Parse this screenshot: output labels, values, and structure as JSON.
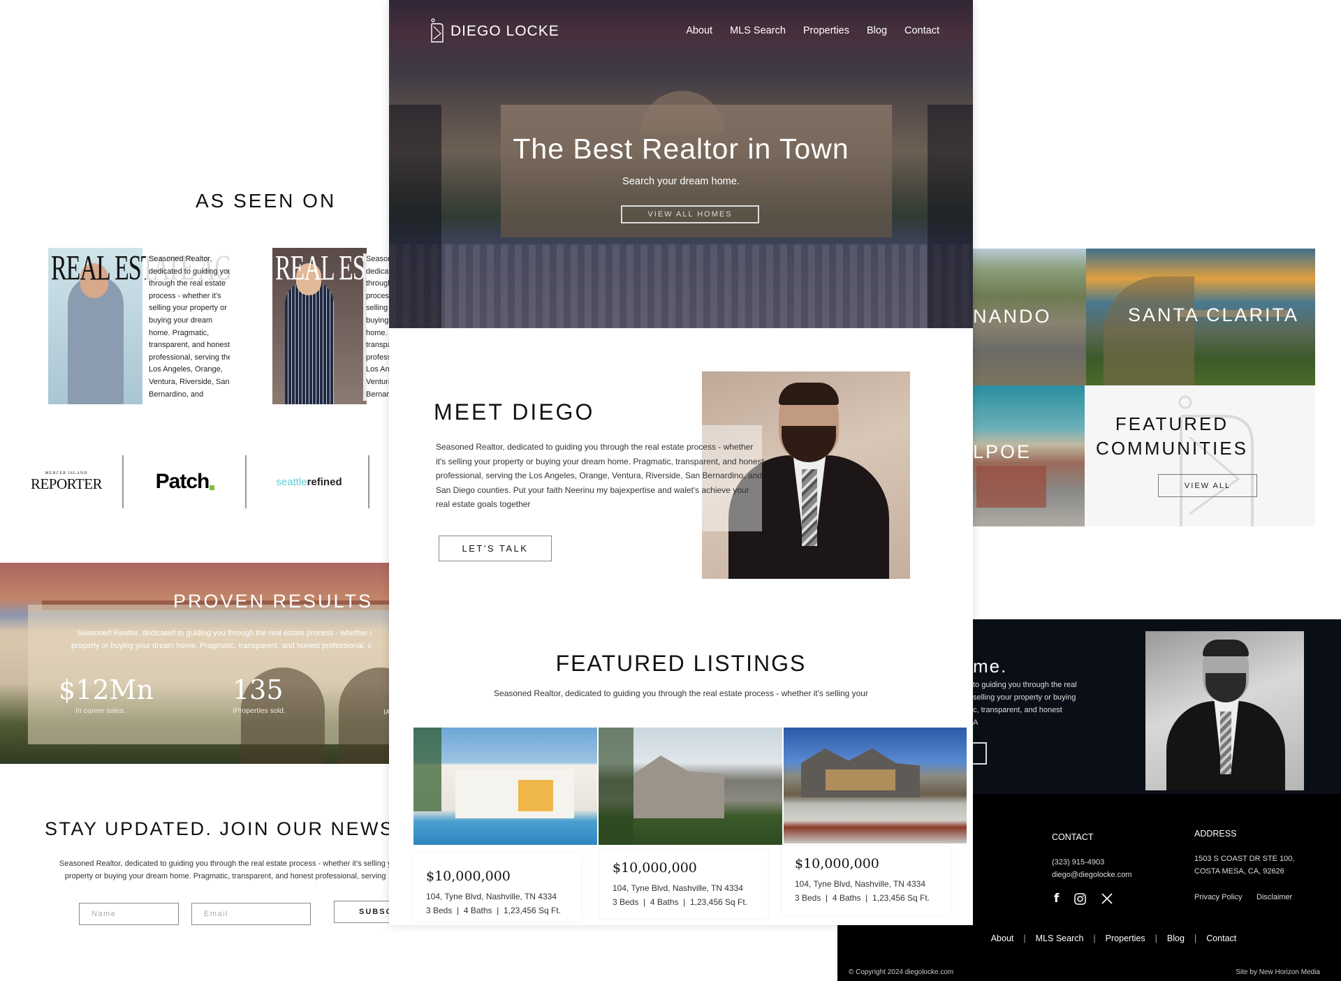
{
  "brand": {
    "name": "DIEGO LOCKE"
  },
  "nav": {
    "items": [
      "About",
      "MLS Search",
      "Properties",
      "Blog",
      "Contact"
    ]
  },
  "hero": {
    "title": "The Best Realtor in Town",
    "subtitle": "Search your dream home.",
    "button": "VIEW ALL HOMES"
  },
  "as_seen_on": {
    "title": "AS SEEN ON",
    "magazines": [
      {
        "masthead": "REAL ESTATE AGENT",
        "text": "Seasoned Realtor, dedicated to guiding you through the real estate process - whether it's selling your property or buying your dream home. Pragmatic, transparent, and honest professional, serving the Los Angeles, Orange, Ventura, Riverside, San Bernardino, and"
      },
      {
        "masthead": "REAL ESTATE AGENT",
        "text": "Seasoned Realtor, dedicated to guiding you through the real estate process - whether it's selling your property or buying your dream home. Pragmatic, transparent, and honest professional, serving the Los Angeles, Orange, Ventura, Riverside, San Bernardino, and"
      }
    ],
    "logos": {
      "reporter_top": "MERCER ISLAND",
      "reporter": "REPORTER",
      "patch": "Patch",
      "seattle_a": "seattle",
      "seattle_b": "refined"
    }
  },
  "meet": {
    "title": "MEET DIEGO",
    "text": "Seasoned Realtor, dedicated to guiding you through the real estate process - whether it's selling your property or buying your dream home. Pragmatic, transparent, and honest professional, serving the Los Angeles, Orange, Ventura, Riverside, San Bernardino, and San Diego counties. Put your faith Neerinu my bajexpertise and walet's achieve your real estate goals together",
    "button": "LET'S TALK"
  },
  "results": {
    "title": "PROVEN RESULTS",
    "text_line1": "Seasoned Realtor, dedicated to guiding you through the real estate process - whether i",
    "text_line2": "property or buying your dream home. Pragmatic, transparent, and honest professional, s",
    "stats": [
      {
        "value": "$12Mn",
        "label": "In career sales."
      },
      {
        "value": "135",
        "label": "IProperties sold."
      },
      {
        "value": "",
        "label": "IA"
      }
    ]
  },
  "newsletter": {
    "title": "STAY UPDATED. JOIN OUR NEWSLETTER",
    "text_line1": "Seasoned Realtor, dedicated to guiding you through the real estate process - whether it's selling your",
    "text_line2": "property or buying your dream home. Pragmatic, transparent, and honest professional, serving",
    "name_placeholder": "Name",
    "email_placeholder": "Email",
    "button": "SUBSCRIBE"
  },
  "listings": {
    "title": "FEATURED LISTINGS",
    "text": "Seasoned Realtor, dedicated to guiding you through the real estate process - whether it's selling your",
    "cards": [
      {
        "price": "$10,000,000",
        "address": "104, Tyne Blvd, Nashville, TN 4334",
        "meta": "3 Beds  |  4 Baths  |  1,23,456 Sq Ft."
      },
      {
        "price": "$10,000,000",
        "address": "104, Tyne Blvd, Nashville, TN 4334",
        "meta": "3 Beds  |  4 Baths  |  1,23,456 Sq Ft."
      },
      {
        "price": "$10,000,000",
        "address": "104, Tyne Blvd, Nashville, TN 4334",
        "meta": "3 Beds  |  4 Baths  |  1,23,456 Sq Ft."
      }
    ]
  },
  "communities": {
    "tiles": [
      "NANDO",
      "SANTA CLARITA",
      "LPOE"
    ],
    "title_line1": "FEATURED",
    "title_line2": "COMMUNITIES",
    "button": "VIEW ALL"
  },
  "about_dark": {
    "title": "me.",
    "lines": [
      "to guiding you through the real",
      "selling your property or buying",
      "c, transparent, and honest",
      "A"
    ]
  },
  "footer": {
    "contact_title": "CONTACT",
    "phone": "(323) 915-4903",
    "email": "diego@diegolocke.com",
    "social": [
      "facebook",
      "instagram",
      "x"
    ],
    "address_title": "ADDRESS",
    "address_line1": "1503 S COAST DR STE 100,",
    "address_line2": "COSTA MESA, CA, 92626",
    "privacy": "Privacy Policy",
    "disclaimer": "Disclaimer",
    "nav": [
      "About",
      "MLS Search",
      "Properties",
      "Blog",
      "Contact"
    ],
    "copyright": "© Copyright 2024 diegolocke.com",
    "credit": "Site by New Horizon Media"
  },
  "colors": {
    "dark_bg": "#0a0f17",
    "footer_bg": "#000000",
    "accent_teal": "#5ccfd6",
    "patch_green": "#7cc242"
  }
}
